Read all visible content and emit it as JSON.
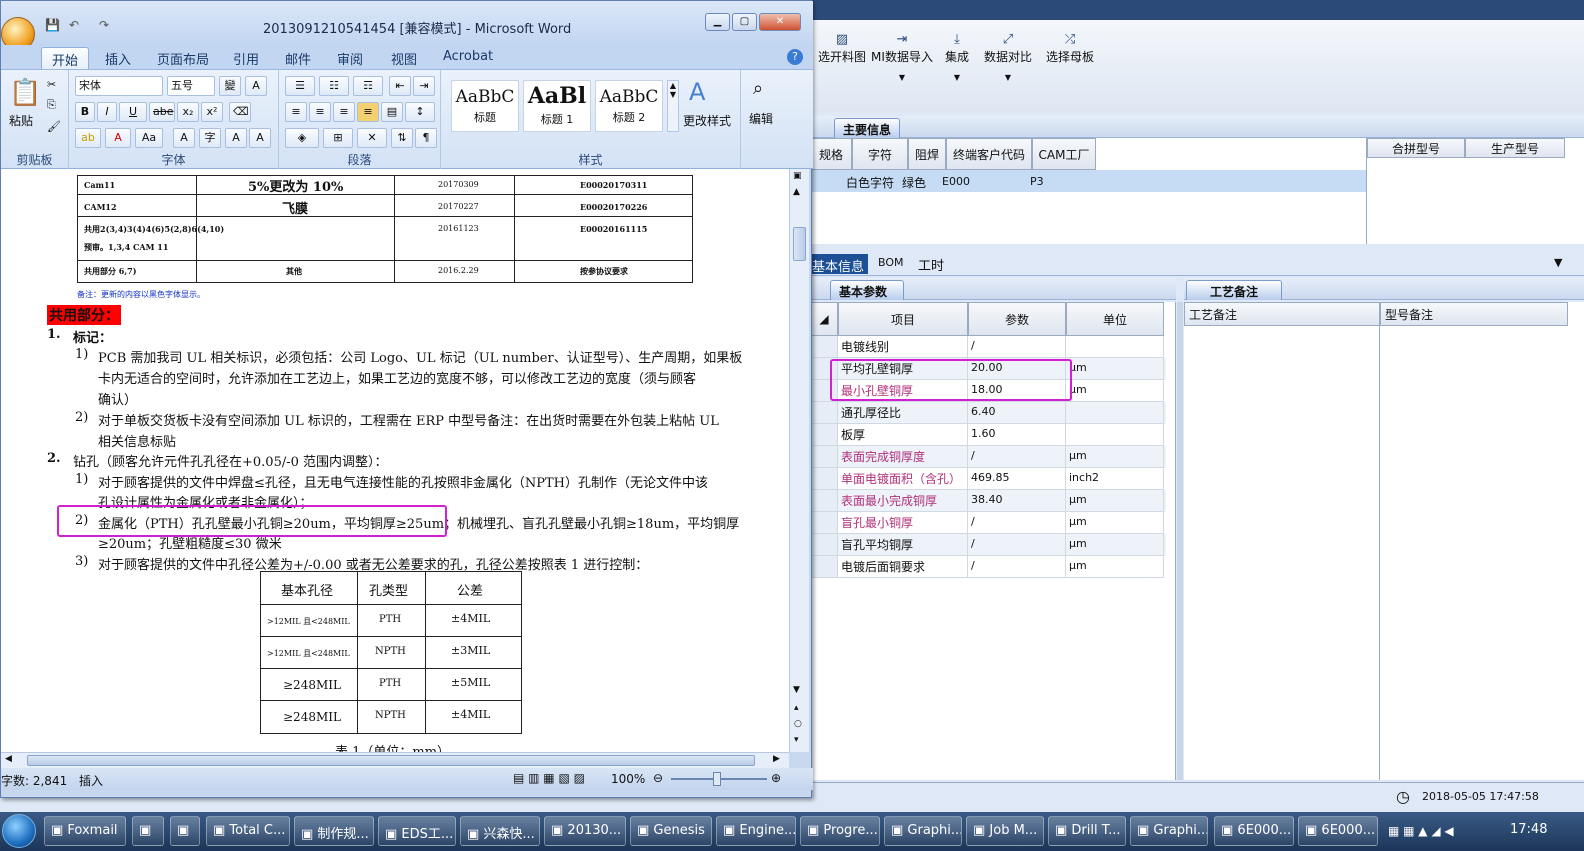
{
  "erp": {
    "toolbar": [
      {
        "label": "选开料图",
        "icon": "image-icon"
      },
      {
        "label": "MI数据导入",
        "icon": "import-icon"
      },
      {
        "label": "集成",
        "icon": "download-icon"
      },
      {
        "label": "数据对比",
        "icon": "compare-icon"
      },
      {
        "label": "选择母板",
        "icon": "shuffle-icon"
      }
    ],
    "main_info_tab": "主要信息",
    "top_grid": {
      "headers": [
        "规格",
        "字符",
        "阻焊",
        "终端客户代码",
        "CAM工厂"
      ],
      "row": [
        "白色字符",
        "绿色",
        "E000",
        "P3"
      ],
      "right_headers": [
        "合拼型号",
        "生产型号"
      ]
    },
    "lower_tabs": [
      "基本信息",
      "BOM",
      "工时"
    ],
    "basic_params_tab": "基本参数",
    "process_notes_tab": "工艺备注",
    "param_headers": [
      "项目",
      "参数",
      "单位"
    ],
    "params": [
      {
        "name": "电镀线别",
        "value": "/",
        "unit": "",
        "hl": false
      },
      {
        "name": "平均孔壁铜厚",
        "value": "20.00",
        "unit": "μm",
        "hl": false
      },
      {
        "name": "最小孔壁铜厚",
        "value": "18.00",
        "unit": "μm",
        "hl": true
      },
      {
        "name": "通孔厚径比",
        "value": "6.40",
        "unit": "",
        "hl": false
      },
      {
        "name": "板厚",
        "value": "1.60",
        "unit": "",
        "hl": false
      },
      {
        "name": "表面完成铜厚度",
        "value": "/",
        "unit": "μm",
        "hl": true
      },
      {
        "name": "单面电镀面积（含孔）",
        "value": "469.85",
        "unit": "inch2",
        "hl": true
      },
      {
        "name": "表面最小完成铜厚",
        "value": "38.40",
        "unit": "μm",
        "hl": true
      },
      {
        "name": "盲孔最小铜厚",
        "value": "/",
        "unit": "μm",
        "hl": true
      },
      {
        "name": "盲孔平均铜厚",
        "value": "/",
        "unit": "μm",
        "hl": false
      },
      {
        "name": "电镀后面铜要求",
        "value": "/",
        "unit": "μm",
        "hl": false
      }
    ],
    "notes_headers": [
      "工艺备注",
      "型号备注"
    ],
    "datetime": "2018-05-05 17:47:58"
  },
  "word": {
    "title": "2013091210541454 [兼容模式] - Microsoft Word",
    "tabs": [
      "开始",
      "插入",
      "页面布局",
      "引用",
      "邮件",
      "审阅",
      "视图",
      "Acrobat"
    ],
    "font_name": "宋体",
    "font_size": "五号",
    "groups": [
      "剪贴板",
      "字体",
      "段落",
      "样式",
      "编辑"
    ],
    "paste": "粘贴",
    "styles": [
      {
        "preview": "AaBbC",
        "label": "标题"
      },
      {
        "preview": "AaBl",
        "label": "标题 1"
      },
      {
        "preview": "AaBbC",
        "label": "标题 2"
      }
    ],
    "change_style": "更改样式",
    "edit": "编辑",
    "status_words": "字数: 2,841",
    "status_insert": "插入",
    "zoom": "100%",
    "doc": {
      "table_rows": [
        {
          "c1": "Cam11",
          "c2": "5%更改为 10%",
          "c3": "20170309",
          "c4": "E00020170311"
        },
        {
          "c1": "CAM12",
          "c2": "飞膜",
          "c3": "20170227",
          "c4": "E00020170226"
        },
        {
          "c1": "共用2(3,4)3(4)4(6)5(2,8)6(4,10)",
          "c1b": "预审。1,3,4 CAM 11",
          "c2": "",
          "c3": "20161123",
          "c4": "E00020161115"
        },
        {
          "c1": "共用部分 6,7)",
          "c2": "其他",
          "c3": "2016.2.29",
          "c4": "按参协议要求"
        }
      ],
      "note": "备注：更新的内容以黑色字体显示。",
      "heading": "共用部分：",
      "s1": "标记：",
      "s1_1a": "PCB 需加我司 UL 相关标识，必须包括：公司 Logo、UL 标记（UL number、认证型号）、生产周期，如果板",
      "s1_1b": "卡内无适合的空间时，允许添加在工艺边上，如果工艺边的宽度不够，可以修改工艺边的宽度（须与顾客",
      "s1_1c": "确认）",
      "s1_2a": "对于单板交货板卡没有空间添加 UL 标识的，工程需在 ERP 中型号备注：在出货时需要在外包装上粘帖 UL",
      "s1_2b": "相关信息标贴",
      "s2": "钻孔（顾客允许元件孔孔径在+0.05/-0 范围内调整）：",
      "s2_1a": "对于顾客提供的文件中焊盘≤孔径，且无电气连接性能的孔按照非金属化（NPTH）孔制作（无论文件中该",
      "s2_1b": "孔设计属性为金属化或者非金属化）；",
      "s2_2a": "金属化（PTH）孔孔壁最小孔铜≥20um，平均铜厚≥25um；机械埋孔、盲孔孔壁最小孔铜≥18um，平均铜厚",
      "s2_2b": "≥20um；孔壁粗糙度≤30 微米",
      "s2_3": "对于顾客提供的文件中孔径公差为+/-0.00 或者无公差要求的孔，孔径公差按照表 1 进行控制：",
      "tol_headers": [
        "基本孔径",
        "孔类型",
        "公差"
      ],
      "tol_rows": [
        [
          ">12MIL 且<248MIL",
          "PTH",
          "±4MIL"
        ],
        [
          ">12MIL 且<248MIL",
          "NPTH",
          "±3MIL"
        ],
        [
          "≥248MIL",
          "PTH",
          "±5MIL"
        ],
        [
          "≥248MIL",
          "NPTH",
          "±4MIL"
        ]
      ],
      "caption": "表 1（单位：mm）"
    }
  },
  "taskbar": {
    "items": [
      "Foxmail",
      "",
      "",
      "Total C...",
      "制作规...",
      "EDS工...",
      "兴森快...",
      "20130...",
      "Genesis",
      "Engine...",
      "Progre...",
      "Graphi...",
      "Job M...",
      "Drill T...",
      "Graphi...",
      "6E000...",
      "6E000..."
    ],
    "clock": "17:48"
  },
  "colors": {
    "highlight_border": "#d020d0",
    "heading_bg": "#ff0000"
  }
}
